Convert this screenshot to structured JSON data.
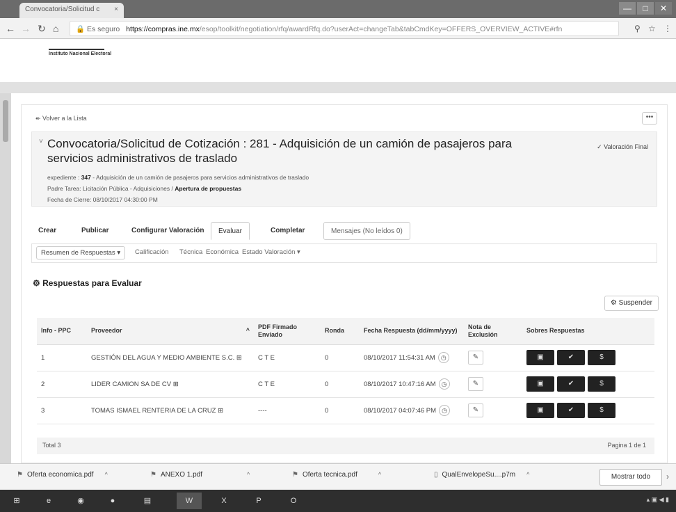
{
  "browser": {
    "tab_title": "Convocatoria/Solicitud c",
    "tab_close": "×",
    "secure_label": "Es seguro",
    "url_host": "https://compras.ine.mx",
    "url_path": "/esop/toolkit/negotiation/rfq/awardRfq.do?userAct=changeTab&tabCmdKey=OFFERS_OVERVIEW_ACTIVE#rfn",
    "min_label": "—",
    "max_label": "□",
    "close_label": "✕"
  },
  "org": {
    "name": "Instituto Nacional Electoral"
  },
  "page": {
    "back_link": "Volver a la Lista",
    "more": "•••",
    "title": "Convocatoria/Solicitud de Cotización : 281 - Adquisición de un camión de pasajeros para servicios administrativos de traslado",
    "valoracion_final": "Valoración Final",
    "expediente_label": "expediente :",
    "expediente_num": "347",
    "expediente_desc": "- Adquisición de un camión de pasajeros para servicios administrativos de traslado",
    "tarea_label": "Padre Tarea: Licitación Pública - Adquisiciones /",
    "tarea_bold": "Apertura de propuestas",
    "fecha_cierre": "Fecha de Cierre: 08/10/2017 04:30:00 PM"
  },
  "tabs": {
    "crear": "Crear",
    "publicar": "Publicar",
    "configurar": "Configurar Valoración",
    "evaluar": "Evaluar",
    "completar": "Completar",
    "mensajes": "Mensajes (No leídos 0)"
  },
  "subtabs": {
    "resumen": "Resumen de Respuestas",
    "calificacion": "Calificación",
    "tecnica": "Técnica",
    "economica": "Económica",
    "estado": "Estado Valoración"
  },
  "section": {
    "title": "Respuestas para Evaluar",
    "suspend": "Suspender"
  },
  "table": {
    "headers": {
      "info": "Info - PPC",
      "proveedor": "Proveedor",
      "pdf": "PDF Firmado Enviado",
      "ronda": "Ronda",
      "fecha": "Fecha Respuesta (dd/mm/yyyy)",
      "nota": "Nota de Exclusión",
      "sobres": "Sobres Respuestas"
    },
    "rows": [
      {
        "num": "1",
        "proveedor": "GESTIÓN DEL AGUA Y MEDIO AMBIENTE S.C.",
        "pdf": "C T E",
        "ronda": "0",
        "fecha": "08/10/2017 11:54:31 AM"
      },
      {
        "num": "2",
        "proveedor": "LIDER CAMION SA DE CV",
        "pdf": "C T E",
        "ronda": "0",
        "fecha": "08/10/2017 10:47:16 AM"
      },
      {
        "num": "3",
        "proveedor": "TOMAS ISMAEL RENTERIA DE LA CRUZ",
        "pdf": "----",
        "ronda": "0",
        "fecha": "08/10/2017 04:07:46 PM"
      }
    ],
    "total": "Total 3",
    "pages": "Pagina 1 de 1"
  },
  "downloads": {
    "items": [
      "Oferta economica.pdf",
      "ANEXO 1.pdf",
      "Oferta tecnica.pdf",
      "QualEnvelopeSu....p7m"
    ],
    "show_all": "Mostrar todo"
  }
}
